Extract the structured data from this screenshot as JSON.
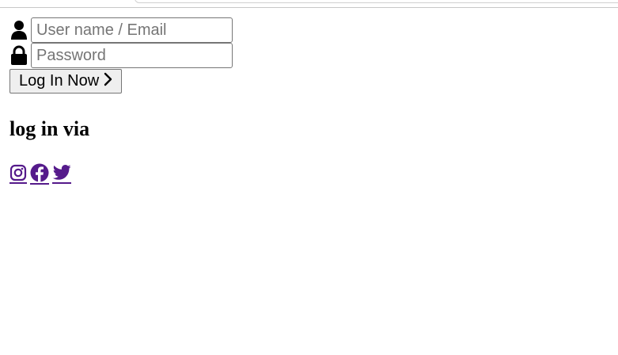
{
  "login": {
    "username_placeholder": "User name / Email",
    "username_value": "",
    "password_placeholder": "Password",
    "password_value": "",
    "submit_label": "Log In Now",
    "submit_icon": "chevron-right-icon",
    "username_icon": "user-icon",
    "password_icon": "lock-icon"
  },
  "social": {
    "heading": "log in via",
    "links": [
      {
        "name": "instagram",
        "icon": "instagram-icon"
      },
      {
        "name": "facebook",
        "icon": "facebook-icon"
      },
      {
        "name": "twitter",
        "icon": "twitter-icon"
      }
    ],
    "link_color": "#551a8b"
  }
}
